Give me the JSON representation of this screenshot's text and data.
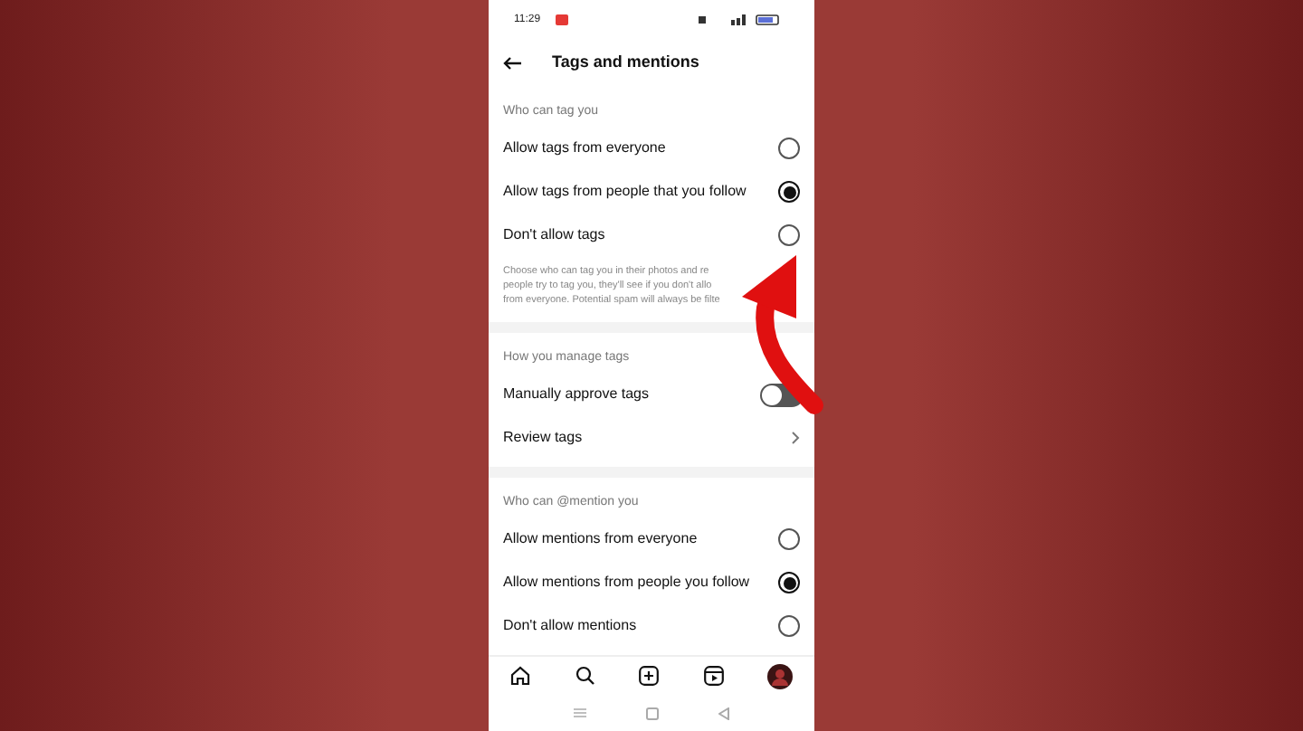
{
  "status_bar": {
    "time": "11:29"
  },
  "header": {
    "title": "Tags and mentions"
  },
  "sections": [
    {
      "heading": "Who can tag you",
      "items": [
        {
          "kind": "radio",
          "label": "Allow tags from everyone",
          "selected": false
        },
        {
          "kind": "radio",
          "label": "Allow tags from people that you follow",
          "selected": true
        },
        {
          "kind": "radio",
          "label": "Don't allow tags",
          "selected": false
        }
      ],
      "note_lines": [
        "Choose who can tag you in their photos and re",
        "people try to tag you, they'll see if you don't allo",
        "from everyone. Potential spam will always be filte"
      ]
    },
    {
      "heading": "How you manage tags",
      "items": [
        {
          "kind": "toggle",
          "label": "Manually approve tags",
          "on": false
        },
        {
          "kind": "link",
          "label": "Review tags"
        }
      ]
    },
    {
      "heading": "Who can @mention you",
      "items": [
        {
          "kind": "radio",
          "label": "Allow mentions from everyone",
          "selected": false
        },
        {
          "kind": "radio",
          "label": "Allow mentions from people you follow",
          "selected": true
        },
        {
          "kind": "radio",
          "label": "Don't allow mentions",
          "selected": false
        }
      ]
    }
  ]
}
